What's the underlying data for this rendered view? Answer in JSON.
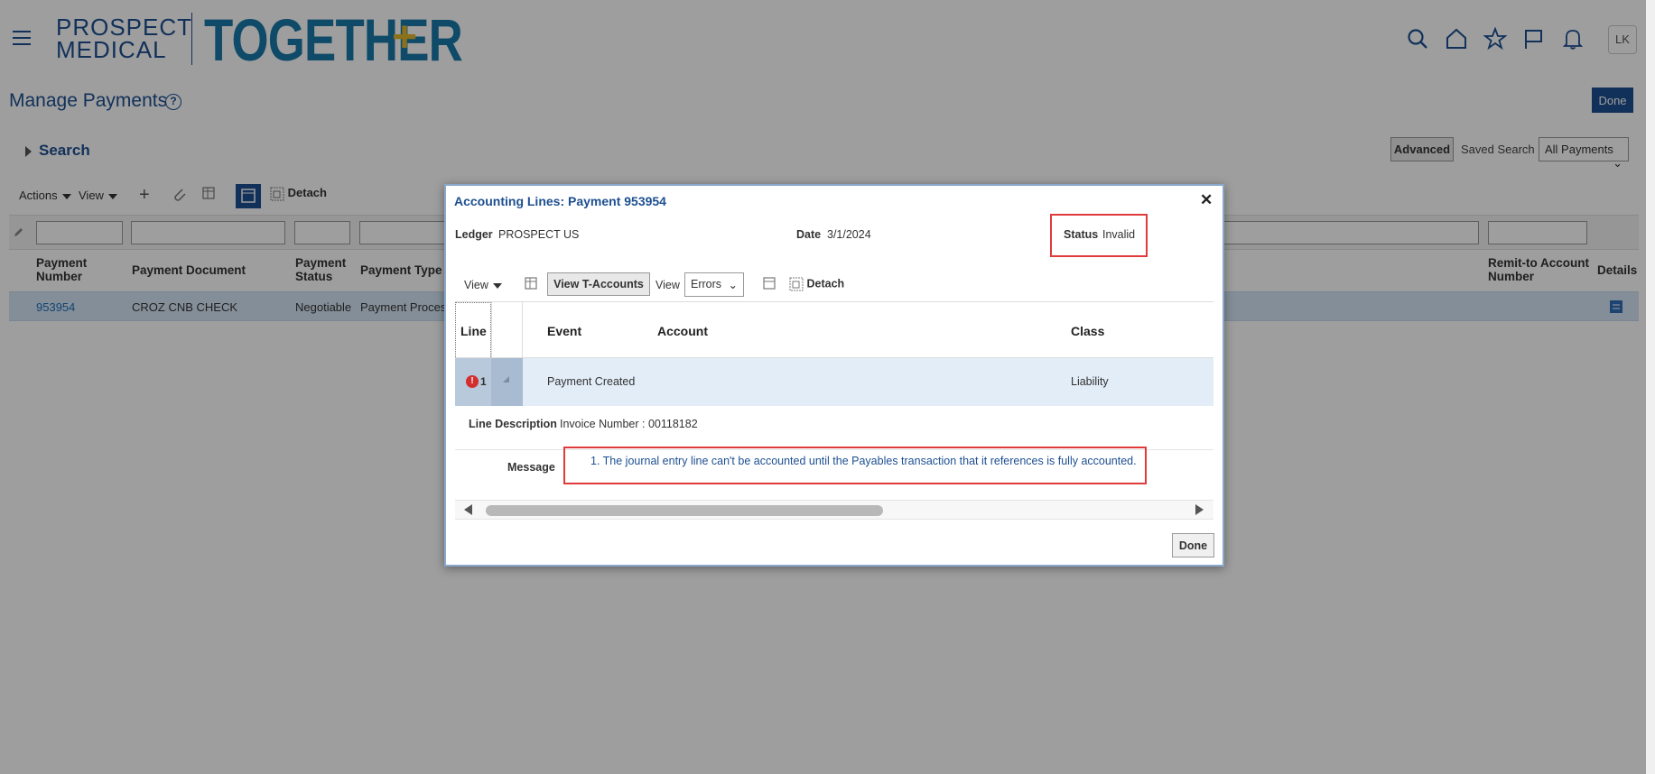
{
  "header": {
    "logo_line1": "PROSPECT",
    "logo_line2": "MEDICAL",
    "logo_brand": "TOGETHER",
    "logo_plus": "+",
    "avatar_initials": "LK",
    "icons": [
      "search-icon",
      "home-icon",
      "star-icon",
      "flag-icon",
      "bell-icon"
    ]
  },
  "page": {
    "title": "Manage Payments",
    "help_icon": "?",
    "done_label": "Done"
  },
  "search": {
    "label": "Search",
    "advanced_label": "Advanced",
    "saved_search_label": "Saved Search",
    "saved_search_value": "All Payments"
  },
  "toolbar": {
    "actions_label": "Actions",
    "view_label": "View",
    "detach_label": "Detach"
  },
  "table": {
    "columns": [
      "Payment Number",
      "Payment Document",
      "Payment Status",
      "Payment Type",
      "Remit-to Account Number",
      "Details"
    ],
    "rows": [
      {
        "payment_number": "953954",
        "payment_document": "CROZ CNB CHECK",
        "payment_status": "Negotiable",
        "payment_type": "Payment Process"
      }
    ]
  },
  "dialog": {
    "title": "Accounting Lines: Payment 953954",
    "ledger_label": "Ledger",
    "ledger_value": "PROSPECT US",
    "date_label": "Date",
    "date_value": "3/1/2024",
    "status_label": "Status",
    "status_value": "Invalid",
    "view_label": "View",
    "view_t_accounts_label": "View T-Accounts",
    "view2_label": "View",
    "view2_value": "Errors",
    "detach_label": "Detach",
    "columns": [
      "Line",
      "Event",
      "Account",
      "Class"
    ],
    "row": {
      "line": "1",
      "event": "Payment Created",
      "account": "",
      "class": "Liability"
    },
    "line_description_label": "Line Description",
    "line_description_value": "Invoice Number : 00118182",
    "message_label": "Message",
    "message_value": "1. The journal entry line can't be accounted until the Payables transaction that it references is fully accounted.",
    "done_label": "Done"
  },
  "colors": {
    "brand_blue": "#1d4f91",
    "logo_teal": "#1979a8",
    "logo_gold": "#e0b72b",
    "highlight_red": "#e03a3a",
    "row_selected": "#d6e6f5"
  }
}
